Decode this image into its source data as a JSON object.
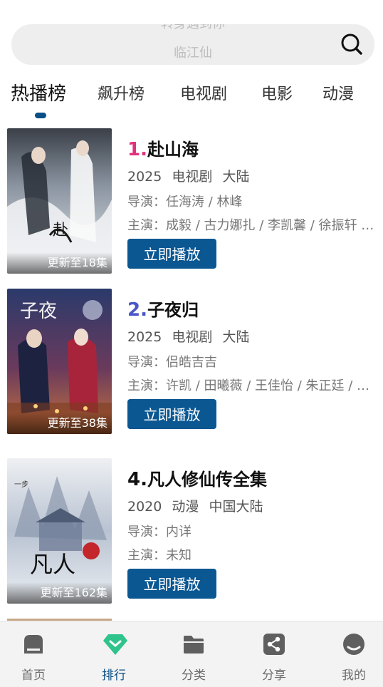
{
  "search": {
    "hint_top": "转身遇到你",
    "hint_main": "临江仙"
  },
  "tabs": [
    {
      "label": "热播榜",
      "active": true
    },
    {
      "label": "飙升榜",
      "active": false
    },
    {
      "label": "电视剧",
      "active": false
    },
    {
      "label": "电影",
      "active": false
    },
    {
      "label": "动漫",
      "active": false
    }
  ],
  "items": [
    {
      "rank": "1.",
      "title": "赴山海",
      "year": "2025",
      "type": "电视剧",
      "region": "大陆",
      "director": "导演：任海涛 / 林峰",
      "cast": "主演：成毅 / 古力娜扎 / 李凯馨 / 徐振轩 / 尹昉",
      "badge": "更新至18集",
      "button": "立即播放"
    },
    {
      "rank": "2.",
      "title": "子夜归",
      "year": "2025",
      "type": "电视剧",
      "region": "大陆",
      "director": "导演：侣皓吉吉",
      "cast": "主演：许凯 / 田曦薇 / 王佳怡 / 朱正廷 / 张淼怡",
      "badge": "更新至38集",
      "button": "立即播放"
    },
    {
      "rank": "4.",
      "title": "凡人修仙传全集",
      "year": "2020",
      "type": "动漫",
      "region": "中国大陆",
      "director": "导演：内详",
      "cast": "主演：未知",
      "badge": "更新至162集",
      "button": "立即播放"
    }
  ],
  "nav": [
    {
      "label": "首页",
      "icon": "home-icon",
      "active": false
    },
    {
      "label": "排行",
      "icon": "ranking-diamond-icon",
      "active": true
    },
    {
      "label": "分类",
      "icon": "folder-icon",
      "active": false
    },
    {
      "label": "分享",
      "icon": "share-icon",
      "active": false
    },
    {
      "label": "我的",
      "icon": "profile-icon",
      "active": false
    }
  ],
  "colors": {
    "accent": "#0a4f86",
    "button": "#0a5792",
    "rank1": "#e2307e",
    "rank2": "#4a56c9",
    "active_nav_icon": "#2ec48b"
  }
}
